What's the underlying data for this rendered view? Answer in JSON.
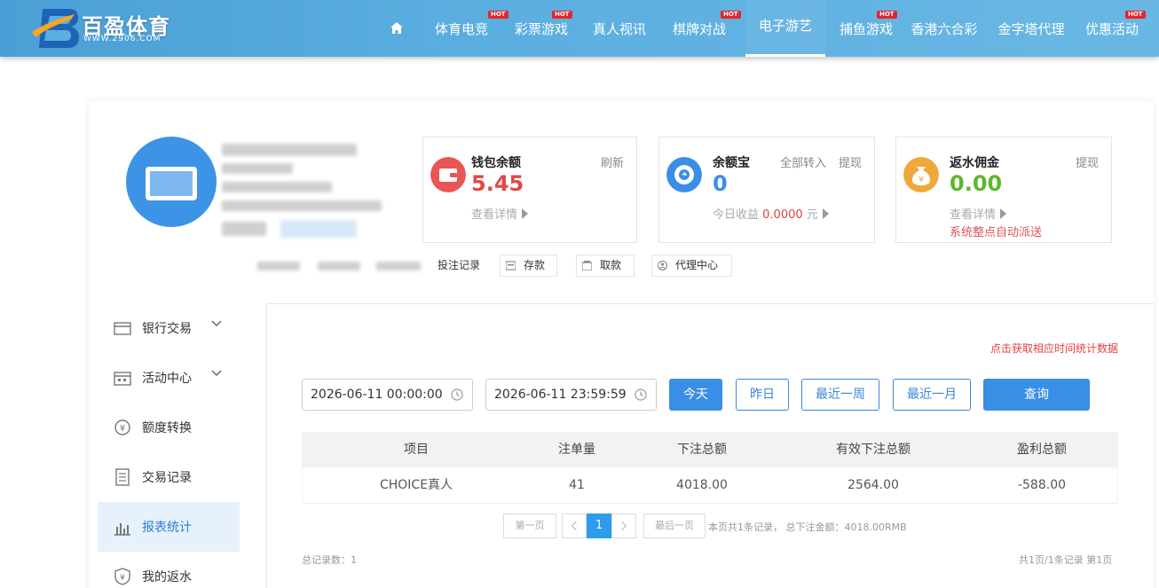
{
  "header": {
    "logo_text": "百盈体育",
    "logo_sub": "WWW.2906.COM",
    "hot_badge": "HOT",
    "nav": [
      {
        "label": "体育电竞",
        "hot": true
      },
      {
        "label": "彩票游戏",
        "hot": true
      },
      {
        "label": "真人视讯",
        "hot": false
      },
      {
        "label": "棋牌对战",
        "hot": true
      },
      {
        "label": "电子游艺",
        "hot": false,
        "active": true
      },
      {
        "label": "捕鱼游戏",
        "hot": true
      },
      {
        "label": "香港六合彩",
        "hot": false
      },
      {
        "label": "金字塔代理",
        "hot": false
      },
      {
        "label": "优惠活动",
        "hot": true
      }
    ]
  },
  "wallets": {
    "wallet": {
      "title": "钱包余额",
      "action": "刷新",
      "value": "5.45",
      "sub": "查看详情"
    },
    "yuebao": {
      "title": "余额宝",
      "action1": "全部转入",
      "action2": "提现",
      "value": "0",
      "sub_prefix": "今日收益",
      "sub_value": "0.0000",
      "sub_unit": "元"
    },
    "rebate": {
      "title": "返水佣金",
      "action": "提现",
      "value": "0.00",
      "sub": "查看详情",
      "note": "系统整点自动派送"
    }
  },
  "quick_links": {
    "bet_record": "投注记录",
    "deposit": "存款",
    "withdraw": "取款",
    "agent": "代理中心"
  },
  "sidebar": [
    {
      "label": "银行交易",
      "has_children": true
    },
    {
      "label": "活动中心",
      "has_children": true
    },
    {
      "label": "额度转换",
      "has_children": false
    },
    {
      "label": "交易记录",
      "has_children": false
    },
    {
      "label": "报表统计",
      "has_children": false,
      "active": true
    },
    {
      "label": "我的返水",
      "has_children": false
    }
  ],
  "report": {
    "hint": "点击获取相应时间统计数据",
    "start_date": "2026-06-11 00:00:00",
    "end_date": "2026-06-11 23:59:59",
    "buttons": {
      "today": "今天",
      "yesterday": "昨日",
      "week": "最近一周",
      "month": "最近一月",
      "query": "查询"
    },
    "columns": [
      "项目",
      "注单量",
      "下注总额",
      "有效下注总额",
      "盈利总额"
    ],
    "rows": [
      [
        "CHOICE真人",
        "41",
        "4018.00",
        "2564.00",
        "-588.00"
      ]
    ],
    "pagination": {
      "first": "第一页",
      "current": "1",
      "last": "最后一页",
      "info": "本页共1条记录， 总下注金额：4018.00RMB"
    },
    "footer_left": "总记录数：1",
    "footer_right": "共1页/1条记录 第1页"
  },
  "colors": {
    "accent": "#3a8ee6",
    "wallet_red": "#e04848",
    "yuebao_blue": "#3a8ee6",
    "rebate_green": "#5db82c",
    "hot_red": "#e4252b"
  }
}
